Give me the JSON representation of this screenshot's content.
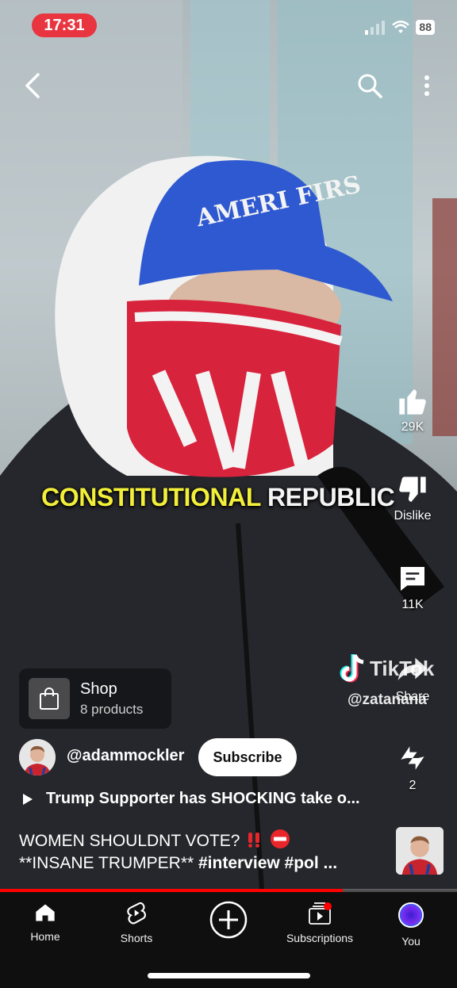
{
  "status_bar": {
    "time": "17:31",
    "battery": "88"
  },
  "video": {
    "caption_highlight": "CONSTITUTIONAL",
    "caption_rest": "REPUBLIC",
    "cap_text": "AMERI FIRS",
    "progress": 0.75
  },
  "actions": {
    "like_count": "29K",
    "dislike_label": "Dislike",
    "comments_count": "11K",
    "share_label": "Share",
    "remix_count": "2"
  },
  "watermark": {
    "brand": "TikTok",
    "handle": "@zatanana"
  },
  "shop": {
    "title": "Shop",
    "subtitle": "8 products"
  },
  "channel": {
    "handle": "@adammockler",
    "subscribe_label": "Subscribe"
  },
  "related_video": "Trump Supporter has SHOCKING take o...",
  "description": {
    "line1": "WOMEN SHOULDNT VOTE?",
    "line2_plain": "**INSANE TRUMPER** ",
    "line2_tags": "#interview #pol ..."
  },
  "nav": {
    "items": [
      {
        "label": "Home"
      },
      {
        "label": "Shorts"
      },
      {
        "label": ""
      },
      {
        "label": "Subscriptions"
      },
      {
        "label": "You"
      }
    ]
  },
  "colors": {
    "accent_red": "#ff0000",
    "status_pill": "#e8353f",
    "caption_yellow": "#f2ef3a"
  },
  "icons": [
    "back-arrow-icon",
    "search-icon",
    "more-vert-icon",
    "thumb-up-icon",
    "thumb-down-icon",
    "comment-icon",
    "share-icon",
    "remix-icon",
    "shopping-bag-icon",
    "play-icon",
    "home-icon",
    "shorts-icon",
    "create-icon",
    "subscriptions-icon",
    "account-icon"
  ]
}
